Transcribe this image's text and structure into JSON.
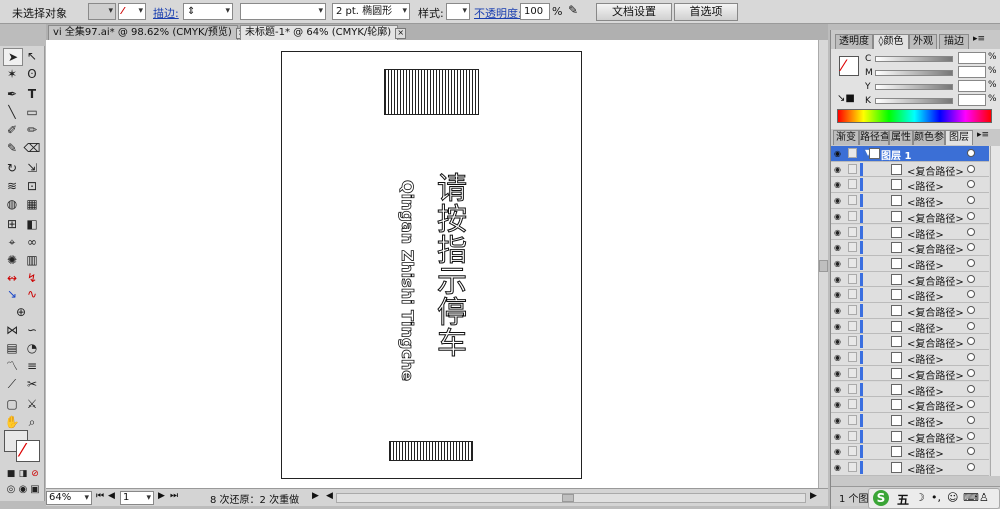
{
  "control_bar": {
    "selection_status": "未选择对象",
    "stroke_label": "描边:",
    "stroke_weight": "2 pt.",
    "brush_preset": "椭圆形",
    "style_label": "样式:",
    "opacity_label": "不透明度:",
    "opacity_value": "100",
    "opacity_unit": "%",
    "doc_setup_button": "文档设置",
    "preferences_button": "首选项"
  },
  "documents": {
    "tabs": [
      {
        "label": "vi 全集97.ai* @ 98.62% (CMYK/预览)"
      },
      {
        "label": "未标题-1* @ 64% (CMYK/轮廓)"
      }
    ]
  },
  "artboard": {
    "chinese_text": "请按指示停车",
    "pinyin_text": "Qingan Zhishi Tingche"
  },
  "status_bar": {
    "zoom": "64%",
    "page": "1",
    "message": "8 次还原：2 次重做"
  },
  "color_panel": {
    "tabs": [
      "透明度",
      "颜色",
      "外观",
      "描边"
    ],
    "channels": [
      "C",
      "M",
      "Y",
      "K"
    ],
    "pct": "%"
  },
  "layers_panel": {
    "tabs": [
      "渐变",
      "路径查",
      "属性",
      "颜色参",
      "图层"
    ],
    "layer_name": "图层 1",
    "items": [
      "<复合路径>",
      "<路径>",
      "<路径>",
      "<复合路径>",
      "<路径>",
      "<复合路径>",
      "<路径>",
      "<复合路径>",
      "<路径>",
      "<复合路径>",
      "<路径>",
      "<复合路径>",
      "<路径>",
      "<复合路径>",
      "<路径>",
      "<复合路径>",
      "<路径>",
      "<复合路径>",
      "<路径>",
      "<路径>",
      "<路径>"
    ],
    "footer_count": "1 个图层"
  },
  "ime": {
    "mode": "五"
  },
  "colors": {
    "layer_highlight": "#3b6fd6",
    "layer_strip": "#3a6fe0"
  }
}
